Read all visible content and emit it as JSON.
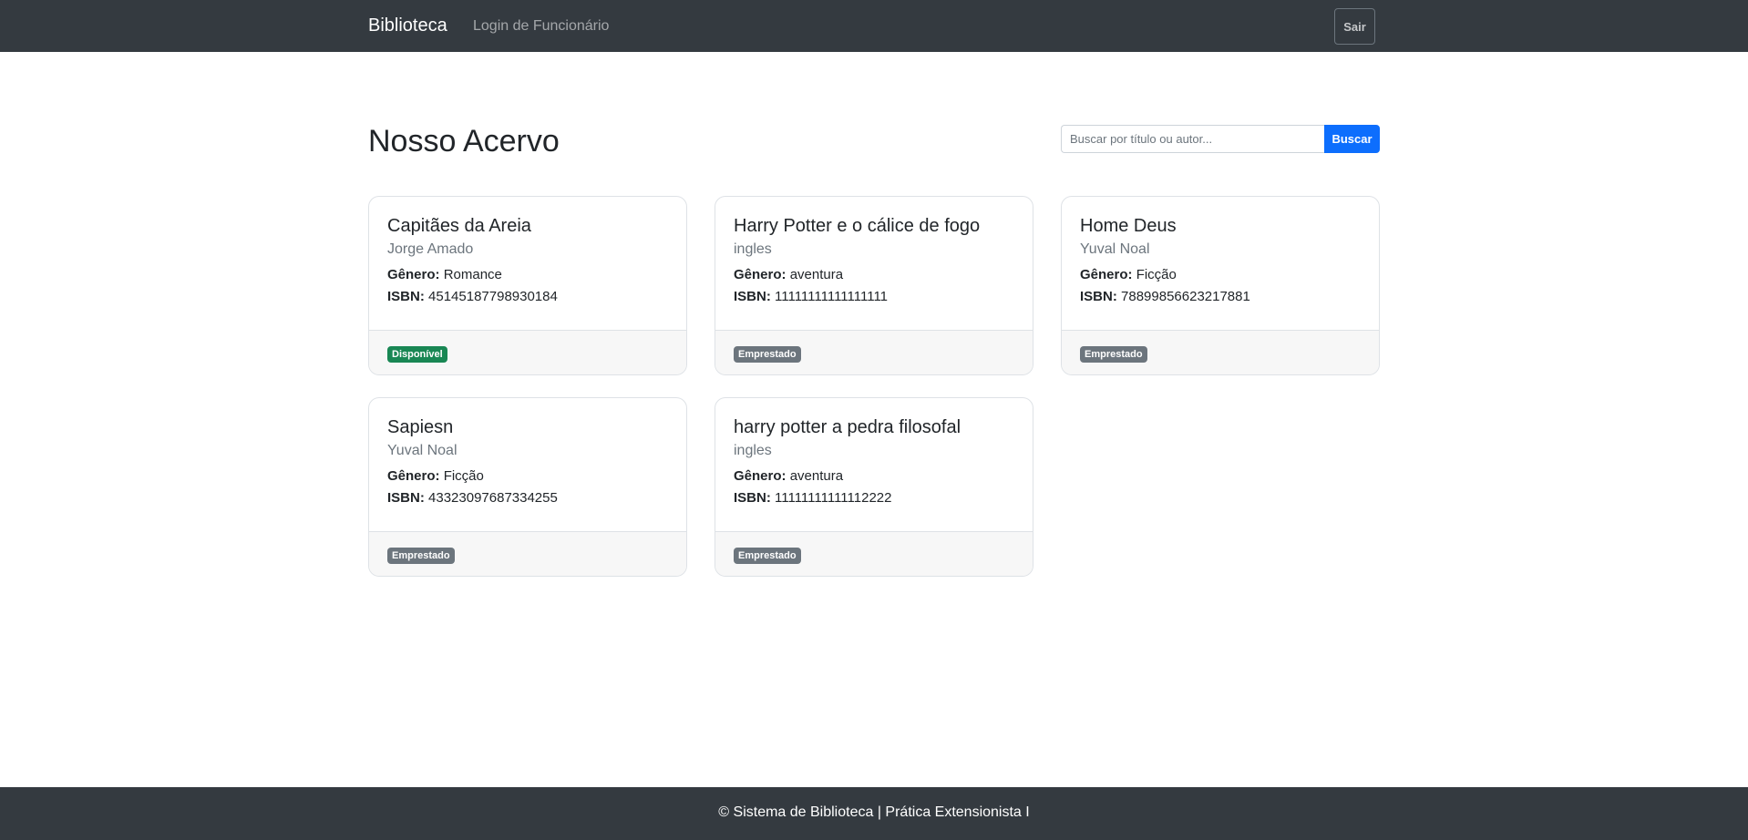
{
  "navbar": {
    "brand": "Biblioteca",
    "login_link": "Login de Funcionário",
    "logout_label": "Sair"
  },
  "main": {
    "title": "Nosso Acervo",
    "search": {
      "placeholder": "Buscar por título ou autor...",
      "value": "",
      "button_label": "Buscar"
    }
  },
  "labels": {
    "genre": "Gênero:",
    "isbn": "ISBN:"
  },
  "books": [
    {
      "title": "Capitães da Areia",
      "author": "Jorge Amado",
      "genre": "Romance",
      "isbn": "45145187798930184",
      "status": "Disponível",
      "status_color": "#198754"
    },
    {
      "title": "Harry Potter e o cálice de fogo",
      "author": "ingles",
      "genre": "aventura",
      "isbn": "11111111111111111",
      "status": "Emprestado",
      "status_color": "#6c757d"
    },
    {
      "title": "Home Deus",
      "author": "Yuval Noal",
      "genre": "Ficção",
      "isbn": "78899856623217881",
      "status": "Emprestado",
      "status_color": "#6c757d"
    },
    {
      "title": "Sapiesn",
      "author": "Yuval Noal",
      "genre": "Ficção",
      "isbn": "43323097687334255",
      "status": "Emprestado",
      "status_color": "#6c757d"
    },
    {
      "title": "harry potter a pedra filosofal",
      "author": "ingles",
      "genre": "aventura",
      "isbn": "11111111111112222",
      "status": "Emprestado",
      "status_color": "#6c757d"
    }
  ],
  "footer": {
    "text": "© Sistema de Biblioteca | Prática Extensionista I"
  }
}
